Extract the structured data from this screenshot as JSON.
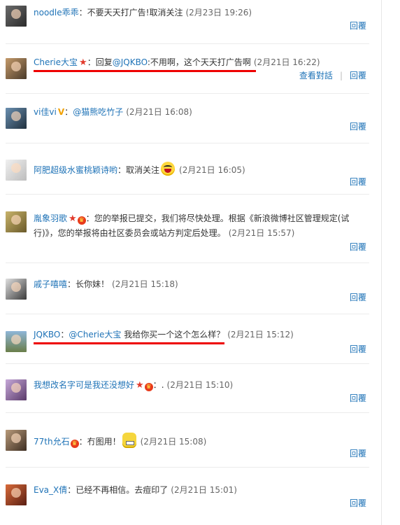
{
  "items": [
    {
      "name": "noodle乖乖",
      "text": "不要天天打广告!取消关注",
      "time": "(2月23日 19:26)"
    },
    {
      "name": "Cherie大宝",
      "reply_prefix": "回复",
      "mention": "@JQKBO",
      "text": ":不用啊，这个天天打广告啊",
      "time": "(2月21日 16:22)",
      "view_dialog": "查看對話"
    },
    {
      "name": "vi佳vi",
      "vip": "V",
      "mention": "@猫熊吃竹子",
      "time": "(2月21日 16:08)"
    },
    {
      "name": "阿肥超级水蜜桃颖诗哟",
      "text": "取消关注",
      "time": "(2月21日 16:05)"
    },
    {
      "name": "胤象羽歌",
      "text": "您的举报已提交，我们将尽快处理。根据《新浪微博社区管理规定(试",
      "text2": "行)》，您的举报将由社区委员会或站方判定后处理。",
      "time": "(2月21日 15:57)"
    },
    {
      "name": "戚子嘻嘻",
      "text": "长你妹！",
      "time": "(2月21日 15:18)"
    },
    {
      "name": "JQKBO",
      "mention": "@Cherie大宝",
      "text": " 我给你买一个这个怎么样？",
      "time": "(2月21日 15:12)"
    },
    {
      "name": "我想改名字可是我还没想好",
      "text": ".",
      "time": "(2月21日 15:10)"
    },
    {
      "name": "77th允石",
      "text": "冇图用！",
      "time": "(2月21日 15:08)"
    },
    {
      "name": "Eva_X倩",
      "text": "已经不再相信。去痘印了",
      "time": "(2月21日 15:01)"
    }
  ],
  "reply_label": "回覆",
  "colon": "：",
  "colors": {
    "link": "#1f73b7",
    "underline": "#e00000",
    "text": "#333333"
  }
}
